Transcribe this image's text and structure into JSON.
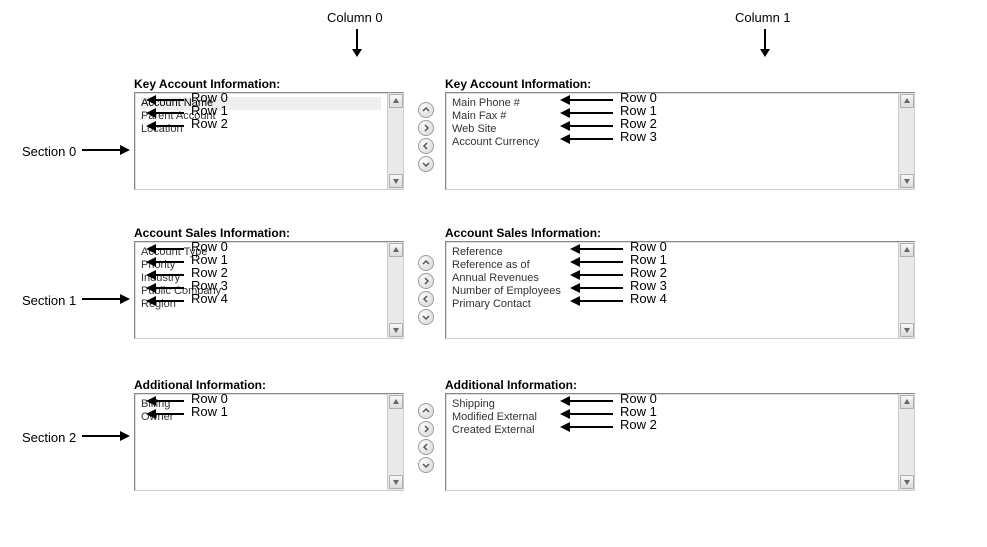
{
  "columns": {
    "0": "Column 0",
    "1": "Column 1"
  },
  "sections": {
    "0": {
      "label": "Section 0",
      "title": "Key Account Information:",
      "col0_items": [
        "Account Name",
        "Parent Account",
        "Location"
      ],
      "col0_row_labels": [
        "Row 0",
        "Row 1",
        "Row 2"
      ],
      "col1_items": [
        "Main Phone #",
        "Main Fax #",
        "Web Site",
        "Account Currency"
      ],
      "col1_row_labels": [
        "Row 0",
        "Row 1",
        "Row 2",
        "Row 3"
      ]
    },
    "1": {
      "label": "Section 1",
      "title": "Account Sales Information:",
      "col0_items": [
        "Account Type",
        "Priority",
        "Industry",
        "Public Company",
        "Region"
      ],
      "col0_row_labels": [
        "Row 0",
        "Row 1",
        "Row 2",
        "Row 3",
        "Row 4"
      ],
      "col1_items": [
        "Reference",
        "Reference as of",
        "Annual Revenues",
        "Number of Employees",
        "Primary Contact"
      ],
      "col1_row_labels": [
        "Row 0",
        "Row 1",
        "Row 2",
        "Row 3",
        "Row 4"
      ]
    },
    "2": {
      "label": "Section 2",
      "title": "Additional Information:",
      "col0_items": [
        "Billing",
        "Owner"
      ],
      "col0_row_labels": [
        "Row 0",
        "Row 1"
      ],
      "col1_items": [
        "Shipping",
        "Modified External",
        "Created External"
      ],
      "col1_row_labels": [
        "Row 0",
        "Row 1",
        "Row 2"
      ]
    }
  },
  "icons": {
    "up": "up-chevron-icon",
    "down": "down-chevron-icon",
    "left": "left-chevron-icon",
    "right": "right-chevron-icon"
  }
}
